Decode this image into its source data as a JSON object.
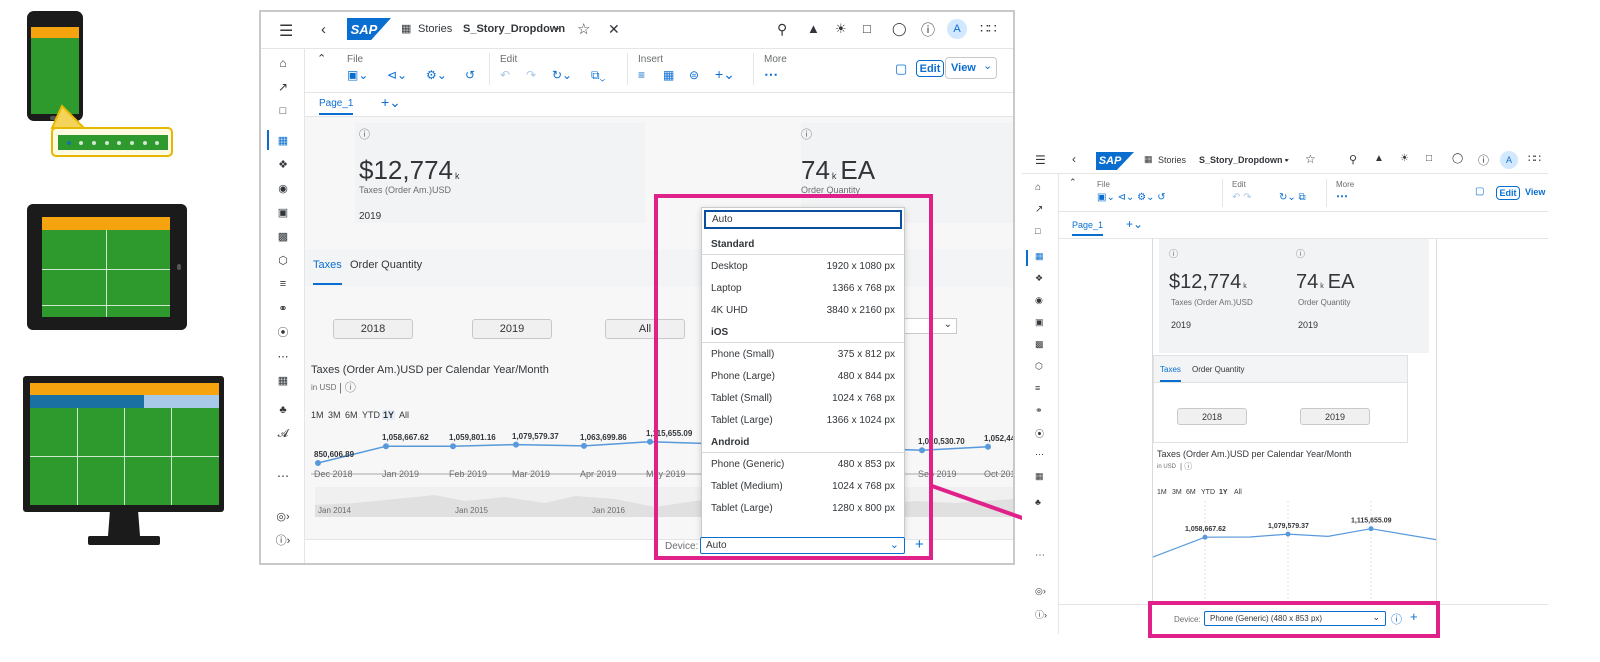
{
  "colors": {
    "brand": "#0a6ed1",
    "highlight": "#e0218a",
    "device_green": "#2e9a2e",
    "device_orange": "#f5a30f",
    "device_blue": "#1a6fa3",
    "device_lightblue": "#a9c9e8"
  },
  "app": {
    "logo": "SAP",
    "stories_label": "Stories",
    "story_name": "S_Story_Dropdown",
    "story_name_small": "S_Story_Dropdown •",
    "avatar": "A"
  },
  "toolbar": {
    "file": "File",
    "edit": "Edit",
    "insert": "Insert",
    "more": "More",
    "edit_btn": "Edit",
    "view_btn": "View"
  },
  "pages": {
    "page1": "Page_1"
  },
  "kpis": [
    {
      "value": "$12,774",
      "scale": "k",
      "unit": "",
      "label": "Taxes (Order Am.)USD",
      "year": "2019"
    },
    {
      "value": "74",
      "scale": "k",
      "unit": "EA",
      "label": "Order Quantity",
      "year": "2019"
    }
  ],
  "tabs": {
    "taxes": "Taxes",
    "order_quantity": "Order Quantity"
  },
  "year_buttons": {
    "y2018": "2018",
    "y2019": "2019",
    "all": "All"
  },
  "chart_title": "Taxes (Order Am.)USD per Calendar Year/Month",
  "chart_subtitle": "in USD",
  "ranges": {
    "m1": "1M",
    "m3": "3M",
    "m6": "6M",
    "ytd": "YTD",
    "y1": "1Y",
    "all": "All"
  },
  "navigator_labels": {
    "j2014": "Jan 2014",
    "j2015": "Jan 2015",
    "j2016": "Jan 2016"
  },
  "chart_data": {
    "type": "line",
    "title": "Taxes (Order Am.)USD per Calendar Year/Month",
    "ylabel": "in USD",
    "x": [
      "Dec 2018",
      "Jan 2019",
      "Feb 2019",
      "Mar 2019",
      "Apr 2019",
      "May 2019",
      "Sep 2019",
      "Oct 2019"
    ],
    "labels": [
      "850,606.89",
      "1,058,667.62",
      "1,059,801.16",
      "1,079,579.37",
      "1,063,699.86",
      "1,115,655.09",
      "1,010,530.70",
      "1,052,440.02"
    ],
    "labels_shown": [
      "850,606.89",
      "1,058,667.62",
      "1,059,801.16",
      "1,079,579.37",
      "1,063,699.86",
      "1,115,6​5.09",
      "010,53​.70",
      "1,052,440.02"
    ],
    "values": [
      850606.89,
      1058667.62,
      1059801.16,
      1079579.37,
      1063699.86,
      1115655.09,
      1010530.7,
      1052440.02
    ],
    "ylim": [
      700000,
      1300000
    ]
  },
  "dropdown": {
    "auto": "Auto",
    "groups": [
      {
        "name": "Standard",
        "items": [
          {
            "label": "Desktop",
            "res": "1920 x 1080 px"
          },
          {
            "label": "Laptop",
            "res": "1366 x 768 px"
          },
          {
            "label": "4K UHD",
            "res": "3840 x 2160 px"
          }
        ]
      },
      {
        "name": "iOS",
        "items": [
          {
            "label": "Phone (Small)",
            "res": "375 x 812 px"
          },
          {
            "label": "Phone (Large)",
            "res": "480 x 844 px"
          },
          {
            "label": "Tablet (Small)",
            "res": "1024 x 768 px"
          },
          {
            "label": "Tablet (Large)",
            "res": "1366 x 1024 px"
          }
        ]
      },
      {
        "name": "Android",
        "items": [
          {
            "label": "Phone (Generic)",
            "res": "480 x 853 px"
          },
          {
            "label": "Tablet (Medium)",
            "res": "1024 x 768 px"
          },
          {
            "label": "Tablet (Large)",
            "res": "1280 x 800 px"
          }
        ]
      }
    ],
    "device_label": "Device:",
    "device_value": "Auto"
  },
  "small": {
    "chart_labels": [
      "1,058,667.62",
      "1,079,579.37",
      "1,115,655.09"
    ],
    "device_label": "Device:",
    "device_value": "Phone (Generic) (480 x 853 px)"
  }
}
